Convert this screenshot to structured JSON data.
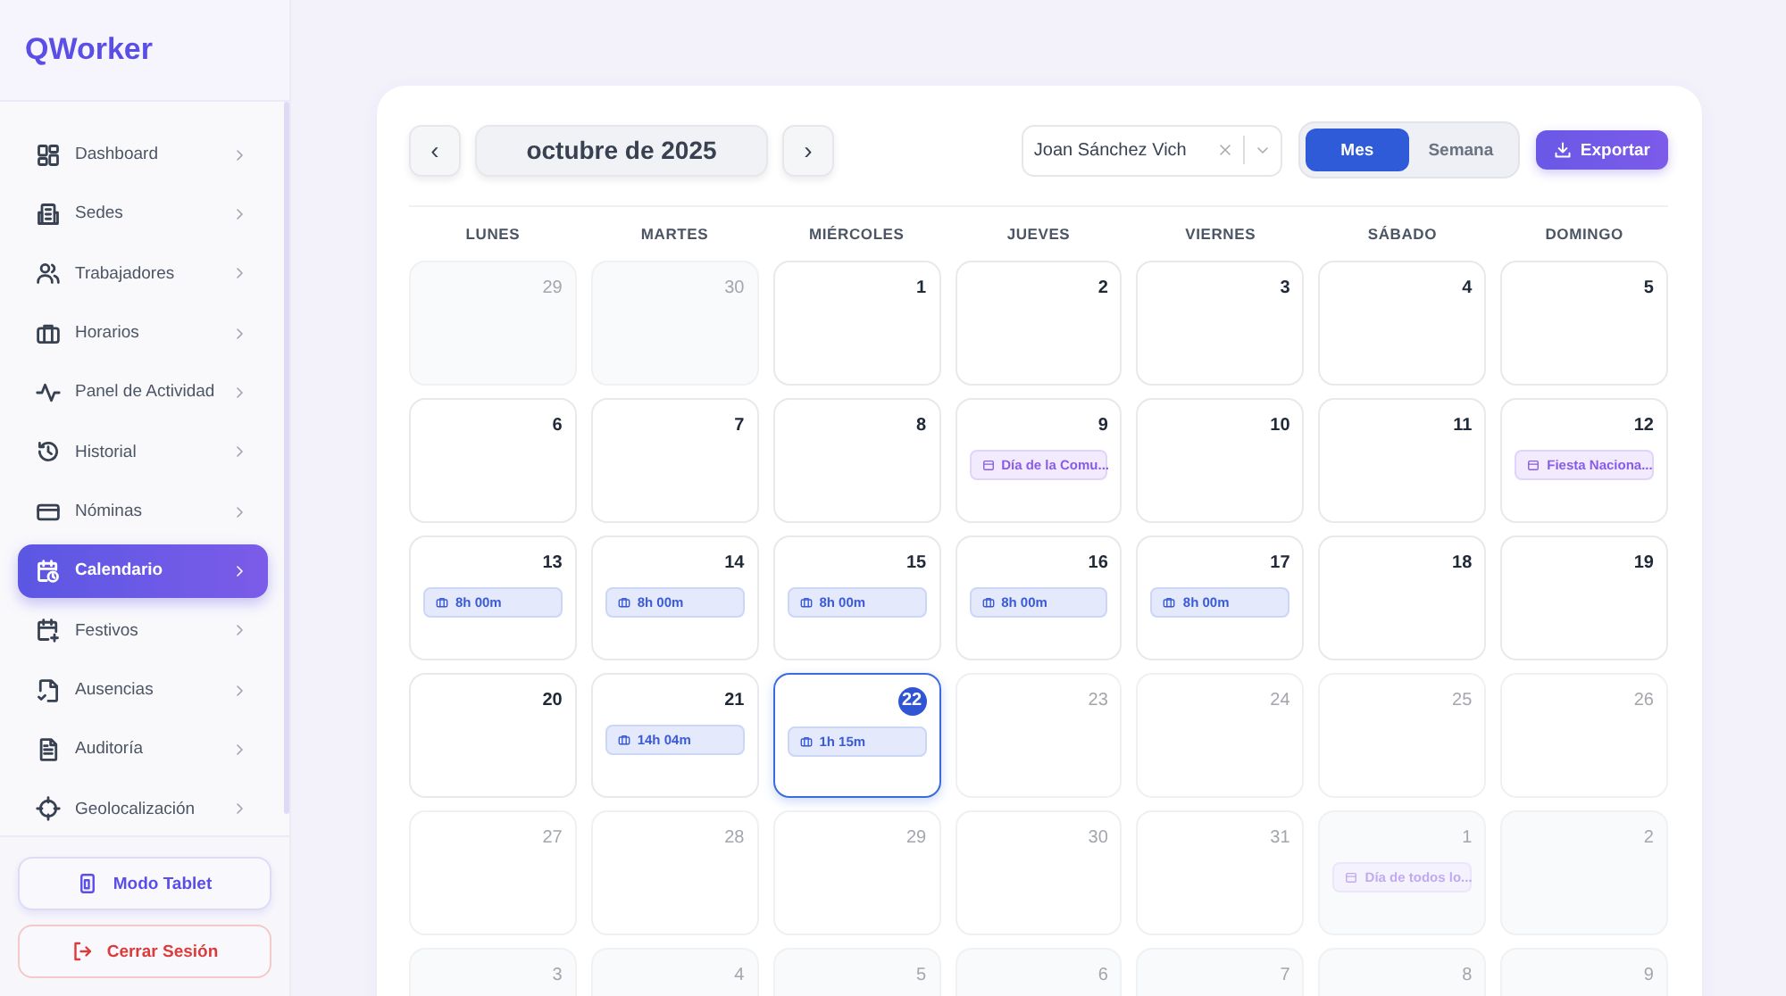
{
  "sidebar": {
    "logo": "QWorker",
    "items": [
      {
        "label": "Dashboard",
        "selected": false
      },
      {
        "label": "Sedes",
        "selected": false
      },
      {
        "label": "Trabajadores",
        "selected": false
      },
      {
        "label": "Horarios",
        "selected": false
      },
      {
        "label": "Panel de Actividad",
        "selected": false
      },
      {
        "label": "Historial",
        "selected": false
      },
      {
        "label": "Nóminas",
        "selected": false
      },
      {
        "label": "Calendario",
        "selected": true
      },
      {
        "label": "Festivos",
        "selected": false
      },
      {
        "label": "Ausencias",
        "selected": false
      },
      {
        "label": "Auditoría",
        "selected": false
      },
      {
        "label": "Geolocalización",
        "selected": false
      }
    ],
    "tablet_button": "Modo Tablet",
    "logout_button": "Cerrar Sesión"
  },
  "calendar": {
    "prev": "‹",
    "month": "octubre de 2025",
    "next": "›",
    "worker_select": {
      "value": "Joan Sánchez Vich"
    },
    "views": [
      {
        "label": "Mes",
        "selected": true
      },
      {
        "label": "Semana",
        "selected": false
      }
    ],
    "export_button": "Exportar",
    "weekdays": [
      "LUNES",
      "MARTES",
      "MIÉRCOLES",
      "JUEVES",
      "VIERNES",
      "SÁBADO",
      "DOMINGO"
    ],
    "weeks": [
      [
        {
          "day": "29",
          "kind": "outside"
        },
        {
          "day": "30",
          "kind": "outside"
        },
        {
          "day": "1",
          "kind": "past"
        },
        {
          "day": "2",
          "kind": "past"
        },
        {
          "day": "3",
          "kind": "past"
        },
        {
          "day": "4",
          "kind": "past"
        },
        {
          "day": "5",
          "kind": "past"
        }
      ],
      [
        {
          "day": "6",
          "kind": "past"
        },
        {
          "day": "7",
          "kind": "past"
        },
        {
          "day": "8",
          "kind": "past"
        },
        {
          "day": "9",
          "kind": "past",
          "events": [
            {
              "kind": "holiday",
              "label": "Día de la Comu..."
            }
          ]
        },
        {
          "day": "10",
          "kind": "past"
        },
        {
          "day": "11",
          "kind": "past"
        },
        {
          "day": "12",
          "kind": "past",
          "events": [
            {
              "kind": "holiday",
              "label": "Fiesta Naciona..."
            }
          ]
        }
      ],
      [
        {
          "day": "13",
          "kind": "past",
          "events": [
            {
              "kind": "shift",
              "label": "8h 00m"
            }
          ]
        },
        {
          "day": "14",
          "kind": "past",
          "events": [
            {
              "kind": "shift",
              "label": "8h 00m"
            }
          ]
        },
        {
          "day": "15",
          "kind": "past",
          "events": [
            {
              "kind": "shift",
              "label": "8h 00m"
            }
          ]
        },
        {
          "day": "16",
          "kind": "past",
          "events": [
            {
              "kind": "shift",
              "label": "8h 00m"
            }
          ]
        },
        {
          "day": "17",
          "kind": "past",
          "events": [
            {
              "kind": "shift",
              "label": "8h 00m"
            }
          ]
        },
        {
          "day": "18",
          "kind": "past"
        },
        {
          "day": "19",
          "kind": "past"
        }
      ],
      [
        {
          "day": "20",
          "kind": "past"
        },
        {
          "day": "21",
          "kind": "past",
          "events": [
            {
              "kind": "shift",
              "label": "14h 04m"
            }
          ]
        },
        {
          "day": "22",
          "kind": "today",
          "events": [
            {
              "kind": "shift",
              "label": "1h 15m"
            }
          ]
        },
        {
          "day": "23",
          "kind": "future"
        },
        {
          "day": "24",
          "kind": "future"
        },
        {
          "day": "25",
          "kind": "future"
        },
        {
          "day": "26",
          "kind": "future"
        }
      ],
      [
        {
          "day": "27",
          "kind": "future"
        },
        {
          "day": "28",
          "kind": "future"
        },
        {
          "day": "29",
          "kind": "future"
        },
        {
          "day": "30",
          "kind": "future"
        },
        {
          "day": "31",
          "kind": "future"
        },
        {
          "day": "1",
          "kind": "outside",
          "events": [
            {
              "kind": "holiday",
              "label": "Día de todos lo..."
            }
          ]
        },
        {
          "day": "2",
          "kind": "outside"
        }
      ],
      [
        {
          "day": "3",
          "kind": "outside"
        },
        {
          "day": "4",
          "kind": "outside"
        },
        {
          "day": "5",
          "kind": "outside"
        },
        {
          "day": "6",
          "kind": "outside"
        },
        {
          "day": "7",
          "kind": "outside"
        },
        {
          "day": "8",
          "kind": "outside"
        },
        {
          "day": "9",
          "kind": "outside"
        }
      ]
    ]
  }
}
